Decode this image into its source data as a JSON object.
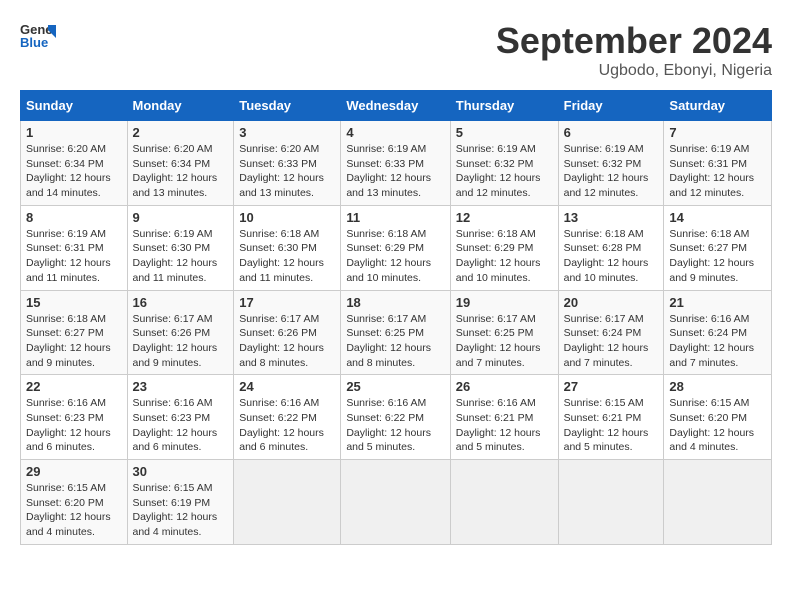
{
  "logo": {
    "line1": "General",
    "line2": "Blue"
  },
  "title": "September 2024",
  "subtitle": "Ugbodo, Ebonyi, Nigeria",
  "days_of_week": [
    "Sunday",
    "Monday",
    "Tuesday",
    "Wednesday",
    "Thursday",
    "Friday",
    "Saturday"
  ],
  "weeks": [
    [
      {
        "day": "1",
        "sunrise": "6:20 AM",
        "sunset": "6:34 PM",
        "daylight": "12 hours and 14 minutes."
      },
      {
        "day": "2",
        "sunrise": "6:20 AM",
        "sunset": "6:34 PM",
        "daylight": "12 hours and 13 minutes."
      },
      {
        "day": "3",
        "sunrise": "6:20 AM",
        "sunset": "6:33 PM",
        "daylight": "12 hours and 13 minutes."
      },
      {
        "day": "4",
        "sunrise": "6:19 AM",
        "sunset": "6:33 PM",
        "daylight": "12 hours and 13 minutes."
      },
      {
        "day": "5",
        "sunrise": "6:19 AM",
        "sunset": "6:32 PM",
        "daylight": "12 hours and 12 minutes."
      },
      {
        "day": "6",
        "sunrise": "6:19 AM",
        "sunset": "6:32 PM",
        "daylight": "12 hours and 12 minutes."
      },
      {
        "day": "7",
        "sunrise": "6:19 AM",
        "sunset": "6:31 PM",
        "daylight": "12 hours and 12 minutes."
      }
    ],
    [
      {
        "day": "8",
        "sunrise": "6:19 AM",
        "sunset": "6:31 PM",
        "daylight": "12 hours and 11 minutes."
      },
      {
        "day": "9",
        "sunrise": "6:19 AM",
        "sunset": "6:30 PM",
        "daylight": "12 hours and 11 minutes."
      },
      {
        "day": "10",
        "sunrise": "6:18 AM",
        "sunset": "6:30 PM",
        "daylight": "12 hours and 11 minutes."
      },
      {
        "day": "11",
        "sunrise": "6:18 AM",
        "sunset": "6:29 PM",
        "daylight": "12 hours and 10 minutes."
      },
      {
        "day": "12",
        "sunrise": "6:18 AM",
        "sunset": "6:29 PM",
        "daylight": "12 hours and 10 minutes."
      },
      {
        "day": "13",
        "sunrise": "6:18 AM",
        "sunset": "6:28 PM",
        "daylight": "12 hours and 10 minutes."
      },
      {
        "day": "14",
        "sunrise": "6:18 AM",
        "sunset": "6:27 PM",
        "daylight": "12 hours and 9 minutes."
      }
    ],
    [
      {
        "day": "15",
        "sunrise": "6:18 AM",
        "sunset": "6:27 PM",
        "daylight": "12 hours and 9 minutes."
      },
      {
        "day": "16",
        "sunrise": "6:17 AM",
        "sunset": "6:26 PM",
        "daylight": "12 hours and 9 minutes."
      },
      {
        "day": "17",
        "sunrise": "6:17 AM",
        "sunset": "6:26 PM",
        "daylight": "12 hours and 8 minutes."
      },
      {
        "day": "18",
        "sunrise": "6:17 AM",
        "sunset": "6:25 PM",
        "daylight": "12 hours and 8 minutes."
      },
      {
        "day": "19",
        "sunrise": "6:17 AM",
        "sunset": "6:25 PM",
        "daylight": "12 hours and 7 minutes."
      },
      {
        "day": "20",
        "sunrise": "6:17 AM",
        "sunset": "6:24 PM",
        "daylight": "12 hours and 7 minutes."
      },
      {
        "day": "21",
        "sunrise": "6:16 AM",
        "sunset": "6:24 PM",
        "daylight": "12 hours and 7 minutes."
      }
    ],
    [
      {
        "day": "22",
        "sunrise": "6:16 AM",
        "sunset": "6:23 PM",
        "daylight": "12 hours and 6 minutes."
      },
      {
        "day": "23",
        "sunrise": "6:16 AM",
        "sunset": "6:23 PM",
        "daylight": "12 hours and 6 minutes."
      },
      {
        "day": "24",
        "sunrise": "6:16 AM",
        "sunset": "6:22 PM",
        "daylight": "12 hours and 6 minutes."
      },
      {
        "day": "25",
        "sunrise": "6:16 AM",
        "sunset": "6:22 PM",
        "daylight": "12 hours and 5 minutes."
      },
      {
        "day": "26",
        "sunrise": "6:16 AM",
        "sunset": "6:21 PM",
        "daylight": "12 hours and 5 minutes."
      },
      {
        "day": "27",
        "sunrise": "6:15 AM",
        "sunset": "6:21 PM",
        "daylight": "12 hours and 5 minutes."
      },
      {
        "day": "28",
        "sunrise": "6:15 AM",
        "sunset": "6:20 PM",
        "daylight": "12 hours and 4 minutes."
      }
    ],
    [
      {
        "day": "29",
        "sunrise": "6:15 AM",
        "sunset": "6:20 PM",
        "daylight": "12 hours and 4 minutes."
      },
      {
        "day": "30",
        "sunrise": "6:15 AM",
        "sunset": "6:19 PM",
        "daylight": "12 hours and 4 minutes."
      },
      null,
      null,
      null,
      null,
      null
    ]
  ]
}
